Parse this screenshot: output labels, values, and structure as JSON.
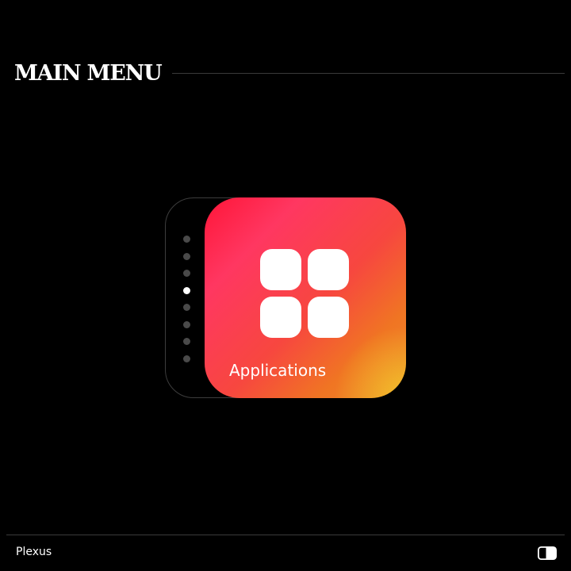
{
  "header": {
    "title": "MAIN MENU"
  },
  "carousel": {
    "dot_count": 8,
    "active_index": 3,
    "card": {
      "label": "Applications",
      "icon": "app-grid-icon",
      "gradient_colors": [
        "#ff1538",
        "#ff3761",
        "#f07523",
        "#f2c02a"
      ]
    }
  },
  "footer": {
    "brand": "Plexus",
    "toggle_icon": "theme-toggle-icon"
  },
  "colors": {
    "background": "#000000",
    "text": "#ffffff",
    "rule": "#3a3a3a",
    "dot_inactive": "#4a4a4a",
    "dot_active": "#ffffff"
  }
}
